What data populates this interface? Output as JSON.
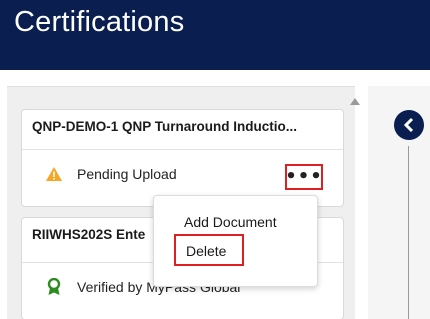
{
  "header": {
    "title": "Certifications"
  },
  "cards": [
    {
      "title": "QNP-DEMO-1 QNP Turnaround Inductio...",
      "status": "Pending Upload",
      "status_icon": "warning-icon",
      "more_label": "•••"
    },
    {
      "title": "RIIWHS202S Ente",
      "status": "Verified by MyPass Global",
      "status_icon": "award-ribbon-icon"
    }
  ],
  "menu": {
    "items": [
      "Add Document",
      "Delete"
    ]
  },
  "colors": {
    "header_bg": "#0a1f4f",
    "highlight": "#e02020",
    "warning": "#f5a623",
    "verified": "#2e8b1f"
  }
}
